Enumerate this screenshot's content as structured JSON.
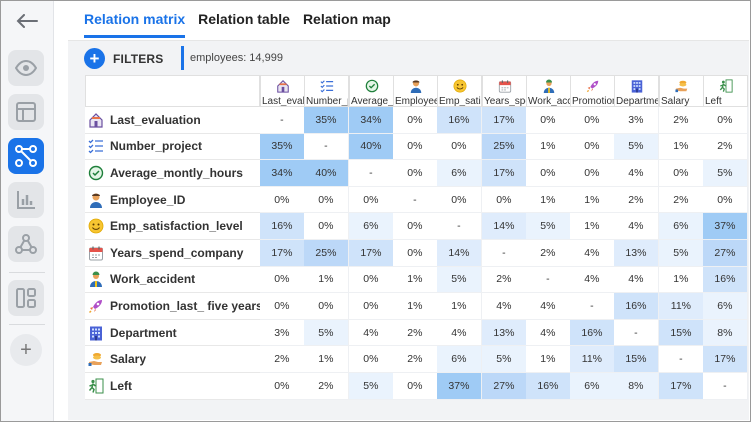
{
  "tabs": [
    {
      "label": "Relation matrix",
      "active": true
    },
    {
      "label": "Relation table",
      "active": false
    },
    {
      "label": "Relation map",
      "active": false
    }
  ],
  "filters": {
    "label": "FILTERS",
    "count_text": "employees: 14,999"
  },
  "rail": {
    "items": [
      {
        "icon": "eye-icon",
        "active": false
      },
      {
        "icon": "layout-icon",
        "active": false
      },
      {
        "icon": "relations-icon",
        "active": true
      },
      {
        "icon": "bar-chart-icon",
        "active": false
      },
      {
        "icon": "network-icon",
        "active": false
      },
      {
        "icon": "dashboard-icon",
        "active": false
      }
    ]
  },
  "colors": {
    "accent": "#1a73e8",
    "heat_low": "#e8f2fd",
    "heat_mid": "#c6dffa",
    "heat_high": "#9fcbf5"
  },
  "matrix": {
    "columns": [
      {
        "label": "Last_evaluation",
        "icon": "house-icon"
      },
      {
        "label": "Number_project",
        "icon": "checklist-icon"
      },
      {
        "label": "Average_montly_hours",
        "icon": "clock-check-icon"
      },
      {
        "label": "Employee_ID",
        "icon": "person-icon"
      },
      {
        "label": "Emp_satisfaction_level",
        "icon": "smiley-icon"
      },
      {
        "label": "Years_spend_company",
        "icon": "calendar-icon"
      },
      {
        "label": "Work_accident",
        "icon": "worker-icon"
      },
      {
        "label": "Promotion_last_five years",
        "icon": "rocket-icon"
      },
      {
        "label": "Department",
        "icon": "building-icon"
      },
      {
        "label": "Salary",
        "icon": "money-hand-icon"
      },
      {
        "label": "Left",
        "icon": "exit-icon"
      }
    ],
    "rows": [
      {
        "label": "Last_evaluation",
        "icon": "house-icon",
        "values": [
          "-",
          "35%",
          "34%",
          "0%",
          "16%",
          "17%",
          "0%",
          "0%",
          "3%",
          "2%",
          "0%"
        ]
      },
      {
        "label": "Number_project",
        "icon": "checklist-icon",
        "values": [
          "35%",
          "-",
          "40%",
          "0%",
          "0%",
          "25%",
          "1%",
          "0%",
          "5%",
          "1%",
          "2%"
        ]
      },
      {
        "label": "Average_montly_hours",
        "icon": "clock-check-icon",
        "values": [
          "34%",
          "40%",
          "-",
          "0%",
          "6%",
          "17%",
          "0%",
          "0%",
          "4%",
          "0%",
          "5%"
        ]
      },
      {
        "label": "Employee_ID",
        "icon": "person-icon",
        "values": [
          "0%",
          "0%",
          "0%",
          "-",
          "0%",
          "0%",
          "1%",
          "1%",
          "2%",
          "2%",
          "0%"
        ]
      },
      {
        "label": "Emp_satisfaction_level",
        "icon": "smiley-icon",
        "values": [
          "16%",
          "0%",
          "6%",
          "0%",
          "-",
          "14%",
          "5%",
          "1%",
          "4%",
          "6%",
          "37%"
        ]
      },
      {
        "label": "Years_spend_company",
        "icon": "calendar-icon",
        "values": [
          "17%",
          "25%",
          "17%",
          "0%",
          "14%",
          "-",
          "2%",
          "4%",
          "13%",
          "5%",
          "27%"
        ]
      },
      {
        "label": "Work_accident",
        "icon": "worker-icon",
        "values": [
          "0%",
          "1%",
          "0%",
          "1%",
          "5%",
          "2%",
          "-",
          "4%",
          "4%",
          "1%",
          "16%"
        ]
      },
      {
        "label": "Promotion_last_ five years",
        "icon": "rocket-icon",
        "values": [
          "0%",
          "0%",
          "0%",
          "1%",
          "1%",
          "4%",
          "4%",
          "-",
          "16%",
          "11%",
          "6%"
        ]
      },
      {
        "label": "Department",
        "icon": "building-icon",
        "values": [
          "3%",
          "5%",
          "4%",
          "2%",
          "4%",
          "13%",
          "4%",
          "16%",
          "-",
          "15%",
          "8%"
        ]
      },
      {
        "label": "Salary",
        "icon": "money-hand-icon",
        "values": [
          "2%",
          "1%",
          "0%",
          "2%",
          "6%",
          "5%",
          "1%",
          "11%",
          "15%",
          "-",
          "17%"
        ]
      },
      {
        "label": "Left",
        "icon": "exit-icon",
        "values": [
          "0%",
          "2%",
          "5%",
          "0%",
          "37%",
          "27%",
          "16%",
          "6%",
          "8%",
          "17%",
          "-"
        ]
      }
    ]
  }
}
